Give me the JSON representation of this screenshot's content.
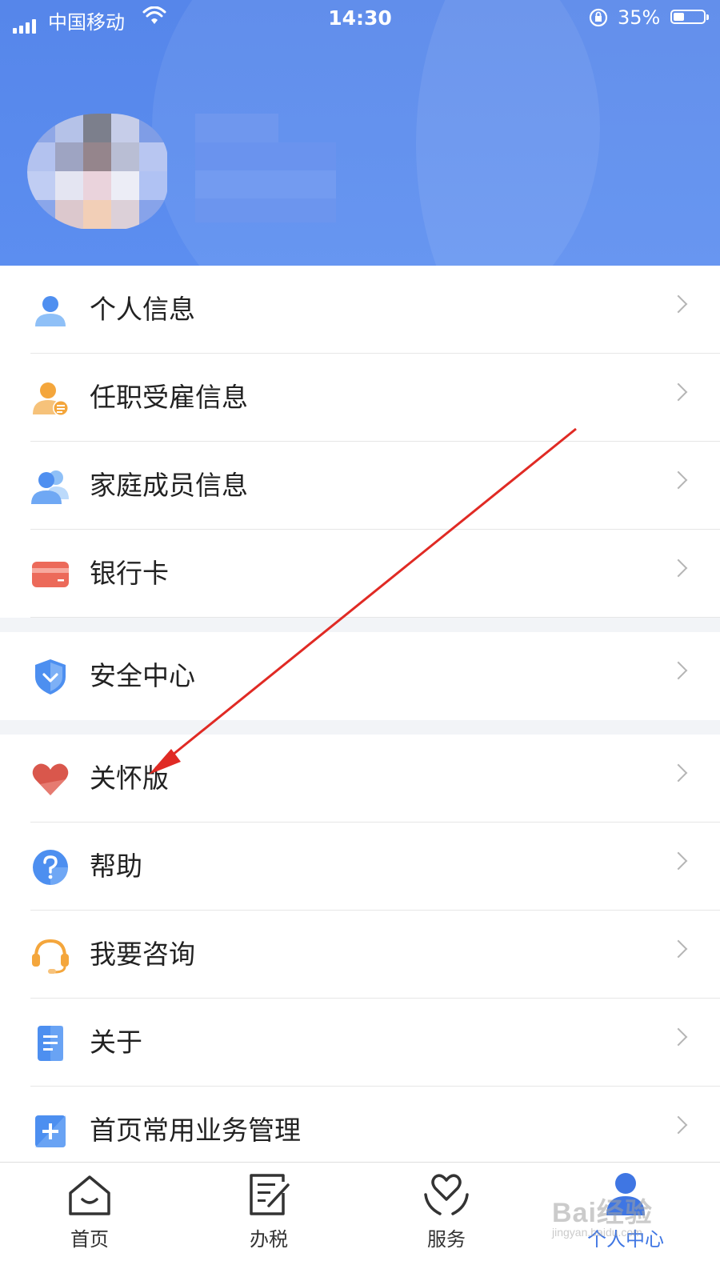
{
  "status_bar": {
    "carrier": "中国移动",
    "time": "14:30",
    "battery": "35%"
  },
  "menu": {
    "group1": [
      {
        "label": "个人信息",
        "icon": "person-icon"
      },
      {
        "label": "任职受雇信息",
        "icon": "employment-icon"
      },
      {
        "label": "家庭成员信息",
        "icon": "family-icon"
      },
      {
        "label": "银行卡",
        "icon": "bank-card-icon"
      }
    ],
    "group2": [
      {
        "label": "安全中心",
        "icon": "shield-icon"
      }
    ],
    "group3": [
      {
        "label": "关怀版",
        "icon": "heart-icon"
      },
      {
        "label": "帮助",
        "icon": "help-icon"
      },
      {
        "label": "我要咨询",
        "icon": "headset-icon"
      },
      {
        "label": "关于",
        "icon": "document-icon"
      },
      {
        "label": "首页常用业务管理",
        "icon": "plus-square-icon"
      }
    ]
  },
  "tabs": [
    {
      "label": "首页",
      "icon": "home-icon"
    },
    {
      "label": "办税",
      "icon": "form-edit-icon"
    },
    {
      "label": "服务",
      "icon": "heart-hands-icon"
    },
    {
      "label": "个人中心",
      "icon": "profile-icon",
      "active": true
    }
  ],
  "watermark": {
    "text": "Bai经验",
    "sub": "jingyan.baidu.com"
  },
  "colors": {
    "header_blue": "#5686ea",
    "active_tab": "#3f76e3",
    "annotation_arrow": "#e02a24"
  }
}
